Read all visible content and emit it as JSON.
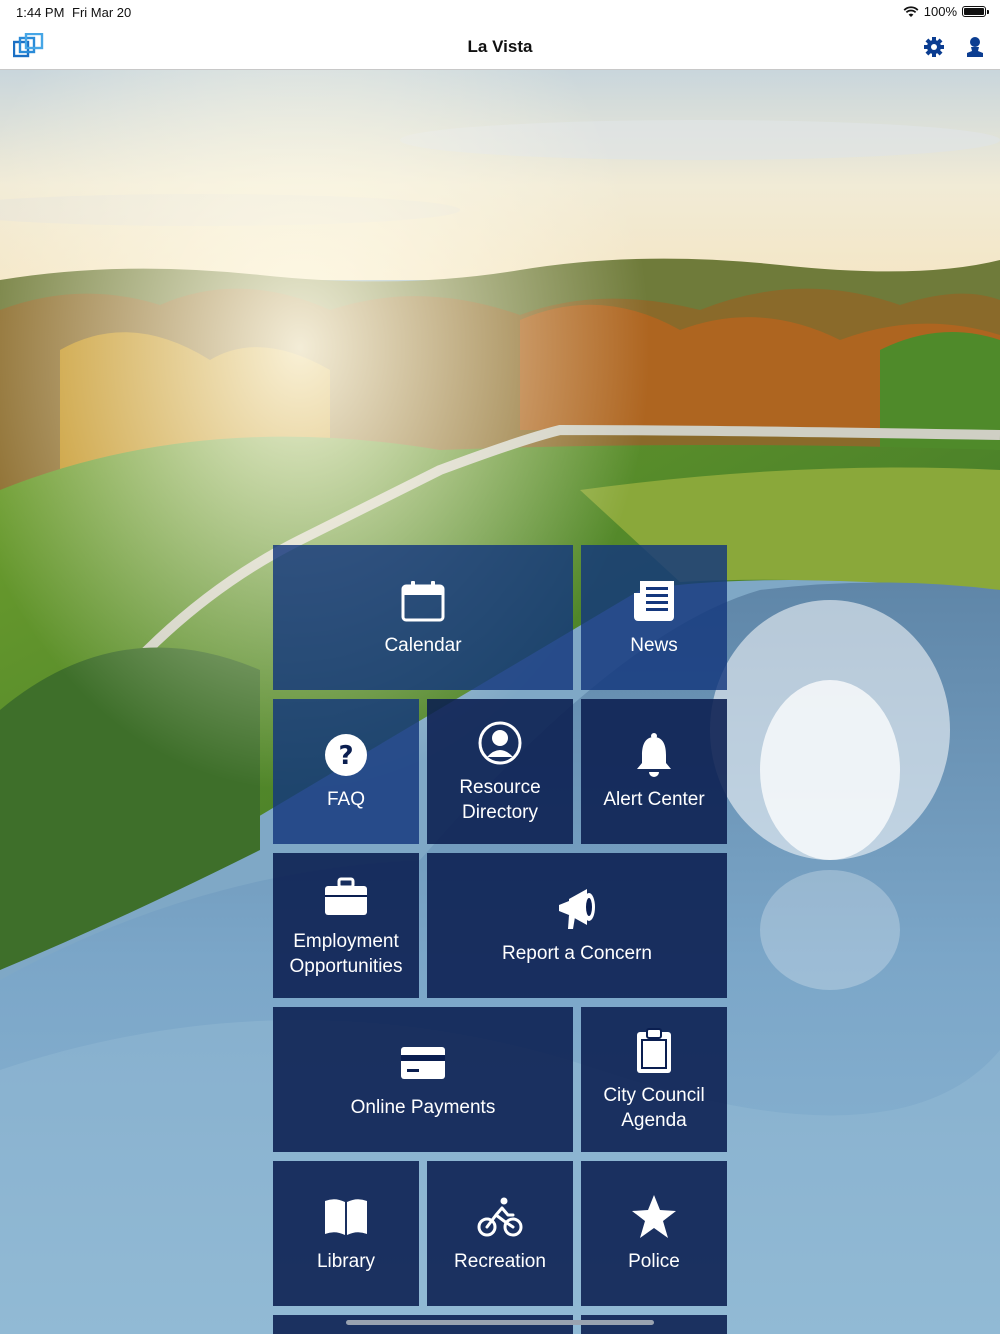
{
  "status_bar": {
    "time": "1:44 PM",
    "date": "Fri Mar 20",
    "battery": "100%"
  },
  "nav": {
    "title": "La Vista",
    "logo_icon": "la-vista-logo-icon",
    "settings_icon": "gear-icon",
    "profile_icon": "user-icon"
  },
  "tiles": [
    {
      "label": "Calendar",
      "icon": "calendar-icon"
    },
    {
      "label": "News",
      "icon": "newspaper-icon"
    },
    {
      "label": "FAQ",
      "icon": "question-circle-icon"
    },
    {
      "label": "Resource\nDirectory",
      "icon": "person-circle-icon"
    },
    {
      "label": "Alert Center",
      "icon": "bell-icon"
    },
    {
      "label": "Employment\nOpportunities",
      "icon": "briefcase-icon"
    },
    {
      "label": "Report a Concern",
      "icon": "megaphone-icon"
    },
    {
      "label": "Online Payments",
      "icon": "credit-card-icon"
    },
    {
      "label": "City Council\nAgenda",
      "icon": "clipboard-icon"
    },
    {
      "label": "Library",
      "icon": "book-icon"
    },
    {
      "label": "Recreation",
      "icon": "bicycle-icon"
    },
    {
      "label": "Police",
      "icon": "star-icon"
    }
  ],
  "colors": {
    "tile_dark": "#0a1e50",
    "tile_light": "#14377d",
    "logo_blue": "#1a6fc4"
  }
}
